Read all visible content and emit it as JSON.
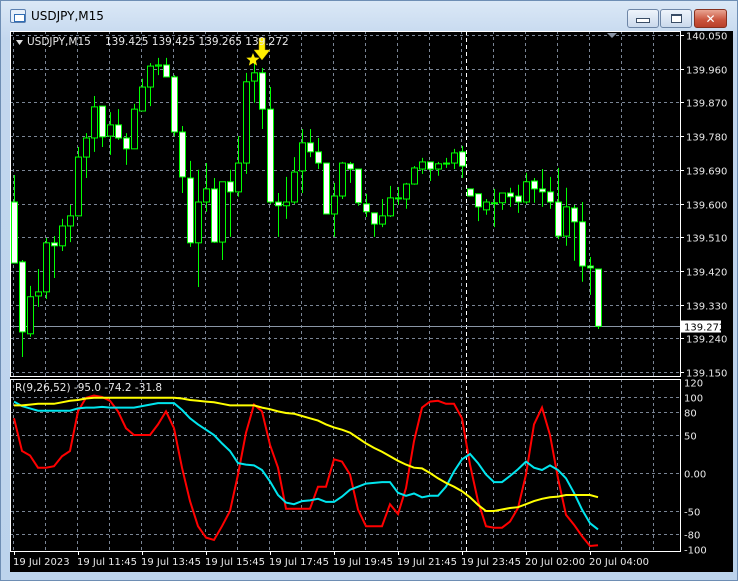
{
  "window": {
    "title": "USDJPY,M15",
    "buttons": [
      {
        "name": "minimize",
        "icon": "minimize-icon"
      },
      {
        "name": "maximize",
        "icon": "maximize-icon"
      },
      {
        "name": "close",
        "icon": "close-icon"
      }
    ]
  },
  "chart_header": {
    "symbol": "USDJPY,M15",
    "ohlc": "139.425 139.425 139.265 139.272"
  },
  "indicator_header": {
    "label": "R(9,26,52) -95.0 -74.2 -31.8"
  },
  "colors": {
    "background": "#000000",
    "candle_outline": "#00ff00",
    "bull_body": "#000000",
    "bear_body": "#ffffff",
    "grid": "#7a8595",
    "line_fast": "#ff0000",
    "line_mid": "#00e5ee",
    "line_slow": "#ffff00",
    "signal": "#ffee00"
  },
  "chart_data": [
    {
      "type": "candlestick",
      "symbol": "USDJPY",
      "timeframe": "M15",
      "ylim": [
        139.15,
        140.05
      ],
      "y_ticks": [
        "140.050",
        "139.960",
        "139.870",
        "139.780",
        "139.690",
        "139.600",
        "139.510",
        "139.420",
        "139.330",
        "139.240",
        "139.150"
      ],
      "current_price": "139.272",
      "grid": true,
      "period_separator_index": 57,
      "signal": {
        "type": "sell-arrow-and-star",
        "candle_index": 30
      },
      "ohlc": [
        [
          139.604,
          139.676,
          139.441,
          139.441
        ],
        [
          139.444,
          139.449,
          139.19,
          139.257
        ],
        [
          139.252,
          139.38,
          139.244,
          139.351
        ],
        [
          139.353,
          139.425,
          139.324,
          139.364
        ],
        [
          139.364,
          139.508,
          139.345,
          139.495
        ],
        [
          139.495,
          139.513,
          139.401,
          139.487
        ],
        [
          139.487,
          139.559,
          139.473,
          139.54
        ],
        [
          139.54,
          139.596,
          139.497,
          139.567
        ],
        [
          139.567,
          139.751,
          139.567,
          139.724
        ],
        [
          139.724,
          139.788,
          139.668,
          139.775
        ],
        [
          139.775,
          139.887,
          139.738,
          139.858
        ],
        [
          139.86,
          139.86,
          139.751,
          139.778
        ],
        [
          139.78,
          139.844,
          139.73,
          139.81
        ],
        [
          139.81,
          139.852,
          139.77,
          139.775
        ],
        [
          139.775,
          139.788,
          139.703,
          139.746
        ],
        [
          139.746,
          139.866,
          139.746,
          139.852
        ],
        [
          139.847,
          139.933,
          139.847,
          139.911
        ],
        [
          139.911,
          139.975,
          139.86,
          139.967
        ],
        [
          139.967,
          139.989,
          139.943,
          139.97
        ],
        [
          139.97,
          139.989,
          139.938,
          139.938
        ],
        [
          139.938,
          139.943,
          139.78,
          139.791
        ],
        [
          139.791,
          139.807,
          139.628,
          139.671
        ],
        [
          139.668,
          139.714,
          139.484,
          139.495
        ],
        [
          139.495,
          139.69,
          139.377,
          139.604
        ],
        [
          139.604,
          139.708,
          139.578,
          139.639
        ],
        [
          139.639,
          139.668,
          139.495,
          139.497
        ],
        [
          139.497,
          139.658,
          139.449,
          139.658
        ],
        [
          139.658,
          139.69,
          139.511,
          139.631
        ],
        [
          139.631,
          139.78,
          139.618,
          139.708
        ],
        [
          139.708,
          139.949,
          139.679,
          139.925
        ],
        [
          139.927,
          139.989,
          139.869,
          139.949
        ],
        [
          139.949,
          139.962,
          139.799,
          139.852
        ],
        [
          139.852,
          139.911,
          139.599,
          139.604
        ],
        [
          139.604,
          139.628,
          139.511,
          139.594
        ],
        [
          139.594,
          139.671,
          139.559,
          139.604
        ],
        [
          139.604,
          139.724,
          139.599,
          139.684
        ],
        [
          139.687,
          139.799,
          139.628,
          139.762
        ],
        [
          139.762,
          139.799,
          139.724,
          139.738
        ],
        [
          139.738,
          139.775,
          139.692,
          139.708
        ],
        [
          139.708,
          139.708,
          139.572,
          139.572
        ],
        [
          139.572,
          139.655,
          139.511,
          139.62
        ],
        [
          139.62,
          139.711,
          139.612,
          139.708
        ],
        [
          139.706,
          139.711,
          139.655,
          139.692
        ],
        [
          139.692,
          139.692,
          139.594,
          139.602
        ],
        [
          139.599,
          139.626,
          139.564,
          139.578
        ],
        [
          139.575,
          139.575,
          139.511,
          139.545
        ],
        [
          139.545,
          139.612,
          139.537,
          139.567
        ],
        [
          139.567,
          139.647,
          139.564,
          139.615
        ],
        [
          139.615,
          139.644,
          139.596,
          139.615
        ],
        [
          139.612,
          139.655,
          139.586,
          139.652
        ],
        [
          139.652,
          139.7,
          139.65,
          139.695
        ],
        [
          139.692,
          139.722,
          139.679,
          139.711
        ],
        [
          139.711,
          139.711,
          139.66,
          139.692
        ],
        [
          139.692,
          139.711,
          139.674,
          139.706
        ],
        [
          139.708,
          139.722,
          139.695,
          139.708
        ],
        [
          139.708,
          139.746,
          139.692,
          139.735
        ],
        [
          139.738,
          139.754,
          139.668,
          139.7
        ],
        [
          139.639,
          139.639,
          139.62,
          139.62
        ],
        [
          139.626,
          139.626,
          139.553,
          139.591
        ],
        [
          139.583,
          139.612,
          139.57,
          139.604
        ],
        [
          139.602,
          139.639,
          139.537,
          139.602
        ],
        [
          139.602,
          139.628,
          139.583,
          139.628
        ],
        [
          139.628,
          139.642,
          139.591,
          139.618
        ],
        [
          139.62,
          139.65,
          139.575,
          139.604
        ],
        [
          139.604,
          139.682,
          139.599,
          139.658
        ],
        [
          139.66,
          139.668,
          139.602,
          139.639
        ],
        [
          139.639,
          139.692,
          139.591,
          139.631
        ],
        [
          139.631,
          139.671,
          139.586,
          139.604
        ],
        [
          139.604,
          139.695,
          139.505,
          139.513
        ],
        [
          139.513,
          139.642,
          139.487,
          139.591
        ],
        [
          139.588,
          139.596,
          139.447,
          139.551
        ],
        [
          139.551,
          139.604,
          139.391,
          139.433
        ],
        [
          139.433,
          139.457,
          139.356,
          139.428
        ],
        [
          139.425,
          139.425,
          139.265,
          139.272
        ]
      ]
    },
    {
      "type": "line",
      "ylim": [
        -100,
        120
      ],
      "y_ticks": [
        "120",
        "100",
        "80",
        "50",
        "0.00",
        "-50",
        "-80",
        "-100"
      ],
      "y_tick_values": [
        120,
        100,
        80,
        50,
        0,
        -50,
        -80,
        -100
      ],
      "grid": true,
      "series": [
        {
          "color": "#ff0000",
          "values": [
            72,
            29,
            23,
            7,
            7,
            9,
            22,
            29,
            81,
            99,
            102,
            100,
            95,
            81,
            59,
            50,
            50,
            50,
            64,
            81,
            59,
            7,
            -37,
            -70,
            -85,
            -88,
            -70,
            -50,
            -2,
            53,
            90,
            81,
            37,
            7,
            -47,
            -47,
            -47,
            -47,
            -18,
            -18,
            18,
            15,
            -2,
            -48,
            -70,
            -70,
            -70,
            -41,
            -54,
            -20,
            42,
            86,
            94,
            95,
            91,
            91,
            72,
            11,
            -37,
            -70,
            -72,
            -72,
            -64,
            -46,
            -2,
            64,
            86,
            50,
            -7,
            -55,
            -68,
            -83,
            -96,
            -95.0
          ]
        },
        {
          "color": "#00e5ee",
          "values": [
            94,
            88,
            85,
            82,
            82,
            82,
            82,
            82,
            85,
            86,
            86,
            87,
            86,
            86,
            86,
            86,
            88,
            90,
            92,
            92,
            92,
            83,
            72,
            64,
            57,
            50,
            39,
            29,
            13,
            11,
            10,
            4,
            -11,
            -29,
            -39,
            -41,
            -37,
            -36,
            -34,
            -38,
            -38,
            -31,
            -22,
            -18,
            -14,
            -13,
            -12,
            -12,
            -26,
            -30,
            -27,
            -32,
            -30,
            -30,
            -18,
            2,
            18,
            25,
            13,
            -2,
            -12,
            -12,
            -4,
            5,
            15,
            7,
            4,
            10,
            4,
            -7,
            -26,
            -48,
            -66,
            -74.2
          ]
        },
        {
          "color": "#ffff00",
          "values": [
            89,
            89,
            90,
            91,
            91,
            91,
            93,
            95,
            96,
            98,
            99,
            99,
            99,
            99,
            99,
            99,
            99,
            99,
            99,
            99,
            99,
            98,
            96,
            95,
            94,
            93,
            91,
            89,
            89,
            89,
            89,
            86,
            84,
            81,
            79,
            78,
            75,
            72,
            69,
            64,
            60,
            57,
            53,
            46,
            39,
            33,
            28,
            22,
            16,
            11,
            7,
            6,
            0,
            -7,
            -13,
            -18,
            -24,
            -32,
            -42,
            -50,
            -50,
            -48,
            -46,
            -45,
            -41,
            -37,
            -34,
            -32,
            -31,
            -29,
            -29,
            -29,
            -29,
            -31.8
          ]
        }
      ]
    }
  ],
  "time_axis": {
    "labels": [
      {
        "text": "19 Jul 2023",
        "index": 0
      },
      {
        "text": "19 Jul 11:45",
        "index": 8
      },
      {
        "text": "19 Jul 13:45",
        "index": 16
      },
      {
        "text": "19 Jul 15:45",
        "index": 24
      },
      {
        "text": "19 Jul 17:45",
        "index": 32
      },
      {
        "text": "19 Jul 19:45",
        "index": 40
      },
      {
        "text": "19 Jul 21:45",
        "index": 48
      },
      {
        "text": "19 Jul 23:45",
        "index": 56
      },
      {
        "text": "20 Jul 02:00",
        "index": 64
      },
      {
        "text": "20 Jul 04:00",
        "index": 72
      }
    ]
  }
}
